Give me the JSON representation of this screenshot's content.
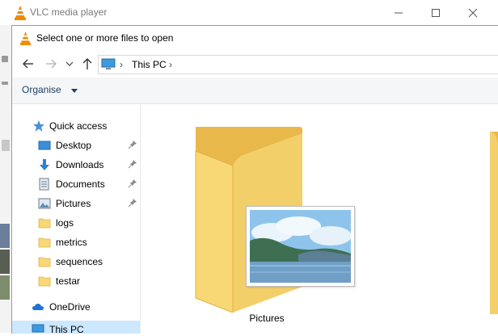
{
  "vlc": {
    "title": "VLC media player"
  },
  "dialog": {
    "title": "Select one or more files to open",
    "address": {
      "crumbs": [
        "This PC"
      ]
    },
    "command_bar": {
      "organise_label": "Organise"
    },
    "nav": {
      "quick_access": "Quick access",
      "items": [
        {
          "label": "Desktop",
          "icon": "desktop-icon",
          "pinned": true
        },
        {
          "label": "Downloads",
          "icon": "downloads-icon",
          "pinned": true
        },
        {
          "label": "Documents",
          "icon": "documents-icon",
          "pinned": true
        },
        {
          "label": "Pictures",
          "icon": "pictures-icon",
          "pinned": true
        },
        {
          "label": "logs",
          "icon": "folder-icon",
          "pinned": false
        },
        {
          "label": "metrics",
          "icon": "folder-icon",
          "pinned": false
        },
        {
          "label": "sequences",
          "icon": "folder-icon",
          "pinned": false
        },
        {
          "label": "testar",
          "icon": "folder-icon",
          "pinned": false
        }
      ],
      "onedrive": "OneDrive",
      "this_pc": "This PC"
    },
    "content": {
      "folders": [
        {
          "label": "Pictures",
          "icon": "pictures-folder-icon"
        }
      ]
    }
  },
  "colors": {
    "folder_yellow": "#f8d775",
    "folder_dark": "#e8b94a",
    "accent_blue": "#1e3f66",
    "selection": "#cce8ff",
    "vlc_orange": "#f08a00"
  }
}
